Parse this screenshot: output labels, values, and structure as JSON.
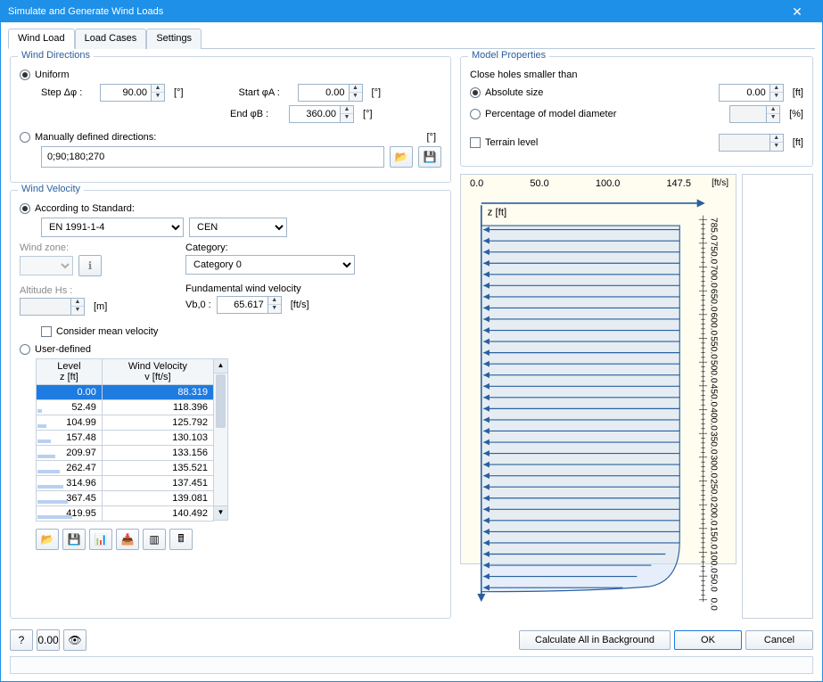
{
  "window": {
    "title": "Simulate and Generate Wind Loads"
  },
  "tabs": {
    "windload": "Wind Load",
    "loadcases": "Load Cases",
    "settings": "Settings"
  },
  "groups": {
    "winddirections": "Wind Directions",
    "windvelocity": "Wind Velocity",
    "modelproperties": "Model Properties"
  },
  "directions": {
    "uniform_label": "Uniform",
    "step_label": "Step Δφ :",
    "start_label": "Start φA :",
    "end_label": "End φB :",
    "step_value": "90.00",
    "start_value": "0.00",
    "end_value": "360.00",
    "deg_unit": "[°]",
    "manual_label": "Manually defined directions:",
    "manual_values": "0;90;180;270"
  },
  "velocity": {
    "according_label": "According to Standard:",
    "standard_value": "EN 1991-1-4",
    "annex_value": "CEN",
    "windzone_label": "Wind zone:",
    "category_label": "Category:",
    "category_value": "Category 0",
    "altitude_label": "Altitude Hs :",
    "altitude_unit": "[m]",
    "fundvel_label": "Fundamental wind velocity",
    "vb0_label": "Vb,0 :",
    "vb0_value": "65.617",
    "vb0_unit": "[ft/s]",
    "meanvel_label": "Consider mean velocity",
    "userdef_label": "User-defined",
    "table_header_level": "Level\nz [ft]",
    "table_header_vel": "Wind Velocity\nv [ft/s]",
    "table": [
      {
        "z": "0.00",
        "v": "88.319",
        "barpct": 0
      },
      {
        "z": "52.49",
        "v": "118.396",
        "barpct": 7
      },
      {
        "z": "104.99",
        "v": "125.792",
        "barpct": 14
      },
      {
        "z": "157.48",
        "v": "130.103",
        "barpct": 20
      },
      {
        "z": "209.97",
        "v": "133.156",
        "barpct": 27
      },
      {
        "z": "262.47",
        "v": "135.521",
        "barpct": 34
      },
      {
        "z": "314.96",
        "v": "137.451",
        "barpct": 40
      },
      {
        "z": "367.45",
        "v": "139.081",
        "barpct": 47
      },
      {
        "z": "419.95",
        "v": "140.492",
        "barpct": 54
      }
    ]
  },
  "modelprops": {
    "closeholes_label": "Close holes smaller than",
    "abs_label": "Absolute size",
    "abs_value": "0.00",
    "abs_unit": "[ft]",
    "pct_label": "Percentage of model diameter",
    "pct_unit": "[%]",
    "terrain_label": "Terrain level",
    "terrain_unit": "[ft]"
  },
  "chart": {
    "x_ticks": [
      "0.0",
      "50.0",
      "100.0",
      "147.5"
    ],
    "x_unit": "[ft/s]",
    "z_label": "z [ft]",
    "y_ticks": [
      "0.0",
      "50.0",
      "100.0",
      "150.0",
      "200.0",
      "250.0",
      "300.0",
      "350.0",
      "400.0",
      "450.0",
      "500.0",
      "550.0",
      "600.0",
      "650.0",
      "700.0",
      "750.0",
      "785.0"
    ]
  },
  "footer": {
    "calc_bg": "Calculate All in Background",
    "ok": "OK",
    "cancel": "Cancel"
  }
}
